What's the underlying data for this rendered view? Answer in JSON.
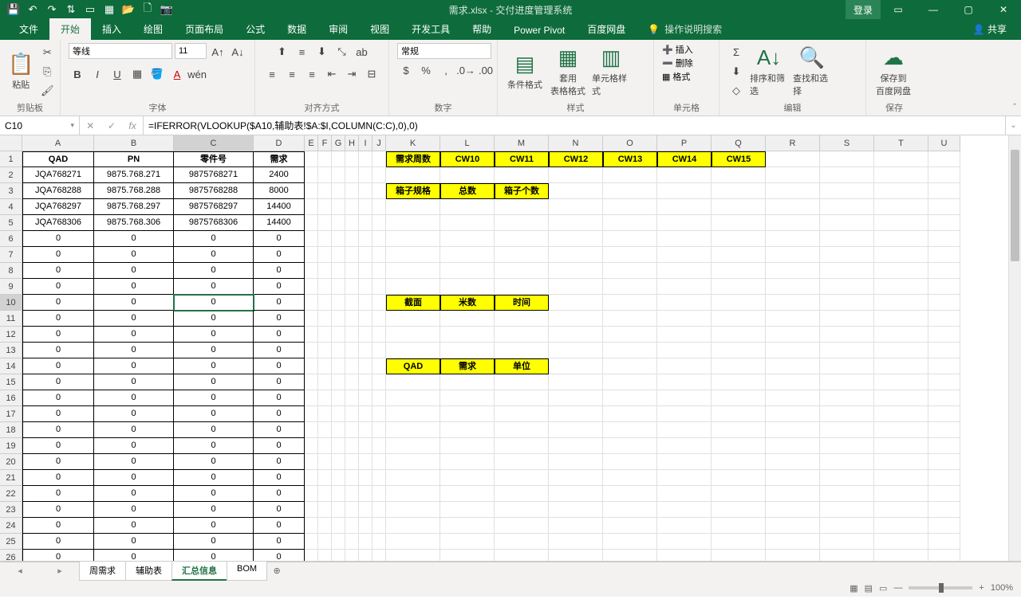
{
  "title": "需求.xlsx - 交付进度管理系统",
  "login": "登录",
  "ribbonTabs": [
    "文件",
    "开始",
    "插入",
    "绘图",
    "页面布局",
    "公式",
    "数据",
    "审阅",
    "视图",
    "开发工具",
    "帮助",
    "Power Pivot",
    "百度网盘"
  ],
  "tellMe": "操作说明搜索",
  "share": "共享",
  "groups": {
    "clipboard": "剪贴板",
    "font": "字体",
    "align": "对齐方式",
    "number": "数字",
    "styles": "样式",
    "cells": "单元格",
    "editing": "编辑",
    "save": "保存",
    "paste": "粘贴",
    "condFmt": "条件格式",
    "tableFmt": "套用\n表格格式",
    "cellStyle": "单元格样式",
    "insert": "插入",
    "delete": "删除",
    "format": "格式",
    "sort": "排序和筛选",
    "find": "查找和选择",
    "baidu": "保存到\n百度网盘",
    "fontName": "等线",
    "fontSize": "11",
    "numFormat": "常规"
  },
  "nameBox": "C10",
  "formula": "=IFERROR(VLOOKUP($A10,辅助表!$A:$I,COLUMN(C:C),0),0)",
  "cols": [
    "A",
    "B",
    "C",
    "D",
    "E",
    "F",
    "G",
    "H",
    "I",
    "J",
    "K",
    "L",
    "M",
    "N",
    "O",
    "P",
    "Q",
    "R",
    "S",
    "T",
    "U"
  ],
  "headerRow": {
    "A": "QAD",
    "B": "PN",
    "C": "零件号",
    "D": "需求"
  },
  "kHeaders": [
    "需求周数",
    "CW10",
    "CW11",
    "CW12",
    "CW13",
    "CW14",
    "CW15"
  ],
  "row3": [
    "箱子规格",
    "总数",
    "箱子个数"
  ],
  "row10": [
    "截面",
    "米数",
    "时间"
  ],
  "row14": [
    "QAD",
    "需求",
    "单位"
  ],
  "table": [
    {
      "A": "JQA768271",
      "B": "9875.768.271",
      "C": "9875768271",
      "D": "2400"
    },
    {
      "A": "JQA768288",
      "B": "9875.768.288",
      "C": "9875768288",
      "D": "8000"
    },
    {
      "A": "JQA768297",
      "B": "9875.768.297",
      "C": "9875768297",
      "D": "14400"
    },
    {
      "A": "JQA768306",
      "B": "9875.768.306",
      "C": "9875768306",
      "D": "14400"
    }
  ],
  "zeroRows": 21,
  "sheets": [
    "周需求",
    "辅助表",
    "汇总信息",
    "BOM"
  ],
  "activeSheet": 2,
  "zoom": "100%"
}
